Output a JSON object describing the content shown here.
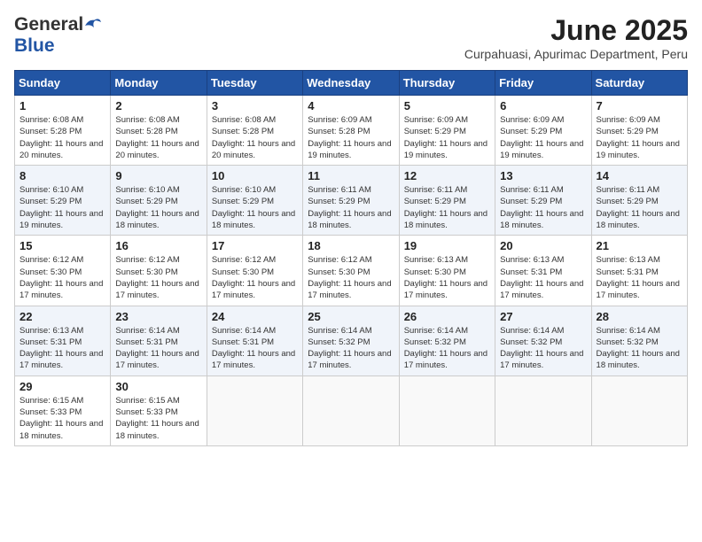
{
  "logo": {
    "general": "General",
    "blue": "Blue"
  },
  "title": {
    "month_year": "June 2025",
    "location": "Curpahuasi, Apurimac Department, Peru"
  },
  "weekdays": [
    "Sunday",
    "Monday",
    "Tuesday",
    "Wednesday",
    "Thursday",
    "Friday",
    "Saturday"
  ],
  "weeks": [
    [
      {
        "day": "1",
        "sunrise": "Sunrise: 6:08 AM",
        "sunset": "Sunset: 5:28 PM",
        "daylight": "Daylight: 11 hours and 20 minutes."
      },
      {
        "day": "2",
        "sunrise": "Sunrise: 6:08 AM",
        "sunset": "Sunset: 5:28 PM",
        "daylight": "Daylight: 11 hours and 20 minutes."
      },
      {
        "day": "3",
        "sunrise": "Sunrise: 6:08 AM",
        "sunset": "Sunset: 5:28 PM",
        "daylight": "Daylight: 11 hours and 20 minutes."
      },
      {
        "day": "4",
        "sunrise": "Sunrise: 6:09 AM",
        "sunset": "Sunset: 5:28 PM",
        "daylight": "Daylight: 11 hours and 19 minutes."
      },
      {
        "day": "5",
        "sunrise": "Sunrise: 6:09 AM",
        "sunset": "Sunset: 5:29 PM",
        "daylight": "Daylight: 11 hours and 19 minutes."
      },
      {
        "day": "6",
        "sunrise": "Sunrise: 6:09 AM",
        "sunset": "Sunset: 5:29 PM",
        "daylight": "Daylight: 11 hours and 19 minutes."
      },
      {
        "day": "7",
        "sunrise": "Sunrise: 6:09 AM",
        "sunset": "Sunset: 5:29 PM",
        "daylight": "Daylight: 11 hours and 19 minutes."
      }
    ],
    [
      {
        "day": "8",
        "sunrise": "Sunrise: 6:10 AM",
        "sunset": "Sunset: 5:29 PM",
        "daylight": "Daylight: 11 hours and 19 minutes."
      },
      {
        "day": "9",
        "sunrise": "Sunrise: 6:10 AM",
        "sunset": "Sunset: 5:29 PM",
        "daylight": "Daylight: 11 hours and 18 minutes."
      },
      {
        "day": "10",
        "sunrise": "Sunrise: 6:10 AM",
        "sunset": "Sunset: 5:29 PM",
        "daylight": "Daylight: 11 hours and 18 minutes."
      },
      {
        "day": "11",
        "sunrise": "Sunrise: 6:11 AM",
        "sunset": "Sunset: 5:29 PM",
        "daylight": "Daylight: 11 hours and 18 minutes."
      },
      {
        "day": "12",
        "sunrise": "Sunrise: 6:11 AM",
        "sunset": "Sunset: 5:29 PM",
        "daylight": "Daylight: 11 hours and 18 minutes."
      },
      {
        "day": "13",
        "sunrise": "Sunrise: 6:11 AM",
        "sunset": "Sunset: 5:29 PM",
        "daylight": "Daylight: 11 hours and 18 minutes."
      },
      {
        "day": "14",
        "sunrise": "Sunrise: 6:11 AM",
        "sunset": "Sunset: 5:29 PM",
        "daylight": "Daylight: 11 hours and 18 minutes."
      }
    ],
    [
      {
        "day": "15",
        "sunrise": "Sunrise: 6:12 AM",
        "sunset": "Sunset: 5:30 PM",
        "daylight": "Daylight: 11 hours and 17 minutes."
      },
      {
        "day": "16",
        "sunrise": "Sunrise: 6:12 AM",
        "sunset": "Sunset: 5:30 PM",
        "daylight": "Daylight: 11 hours and 17 minutes."
      },
      {
        "day": "17",
        "sunrise": "Sunrise: 6:12 AM",
        "sunset": "Sunset: 5:30 PM",
        "daylight": "Daylight: 11 hours and 17 minutes."
      },
      {
        "day": "18",
        "sunrise": "Sunrise: 6:12 AM",
        "sunset": "Sunset: 5:30 PM",
        "daylight": "Daylight: 11 hours and 17 minutes."
      },
      {
        "day": "19",
        "sunrise": "Sunrise: 6:13 AM",
        "sunset": "Sunset: 5:30 PM",
        "daylight": "Daylight: 11 hours and 17 minutes."
      },
      {
        "day": "20",
        "sunrise": "Sunrise: 6:13 AM",
        "sunset": "Sunset: 5:31 PM",
        "daylight": "Daylight: 11 hours and 17 minutes."
      },
      {
        "day": "21",
        "sunrise": "Sunrise: 6:13 AM",
        "sunset": "Sunset: 5:31 PM",
        "daylight": "Daylight: 11 hours and 17 minutes."
      }
    ],
    [
      {
        "day": "22",
        "sunrise": "Sunrise: 6:13 AM",
        "sunset": "Sunset: 5:31 PM",
        "daylight": "Daylight: 11 hours and 17 minutes."
      },
      {
        "day": "23",
        "sunrise": "Sunrise: 6:14 AM",
        "sunset": "Sunset: 5:31 PM",
        "daylight": "Daylight: 11 hours and 17 minutes."
      },
      {
        "day": "24",
        "sunrise": "Sunrise: 6:14 AM",
        "sunset": "Sunset: 5:31 PM",
        "daylight": "Daylight: 11 hours and 17 minutes."
      },
      {
        "day": "25",
        "sunrise": "Sunrise: 6:14 AM",
        "sunset": "Sunset: 5:32 PM",
        "daylight": "Daylight: 11 hours and 17 minutes."
      },
      {
        "day": "26",
        "sunrise": "Sunrise: 6:14 AM",
        "sunset": "Sunset: 5:32 PM",
        "daylight": "Daylight: 11 hours and 17 minutes."
      },
      {
        "day": "27",
        "sunrise": "Sunrise: 6:14 AM",
        "sunset": "Sunset: 5:32 PM",
        "daylight": "Daylight: 11 hours and 17 minutes."
      },
      {
        "day": "28",
        "sunrise": "Sunrise: 6:14 AM",
        "sunset": "Sunset: 5:32 PM",
        "daylight": "Daylight: 11 hours and 18 minutes."
      }
    ],
    [
      {
        "day": "29",
        "sunrise": "Sunrise: 6:15 AM",
        "sunset": "Sunset: 5:33 PM",
        "daylight": "Daylight: 11 hours and 18 minutes."
      },
      {
        "day": "30",
        "sunrise": "Sunrise: 6:15 AM",
        "sunset": "Sunset: 5:33 PM",
        "daylight": "Daylight: 11 hours and 18 minutes."
      },
      null,
      null,
      null,
      null,
      null
    ]
  ]
}
